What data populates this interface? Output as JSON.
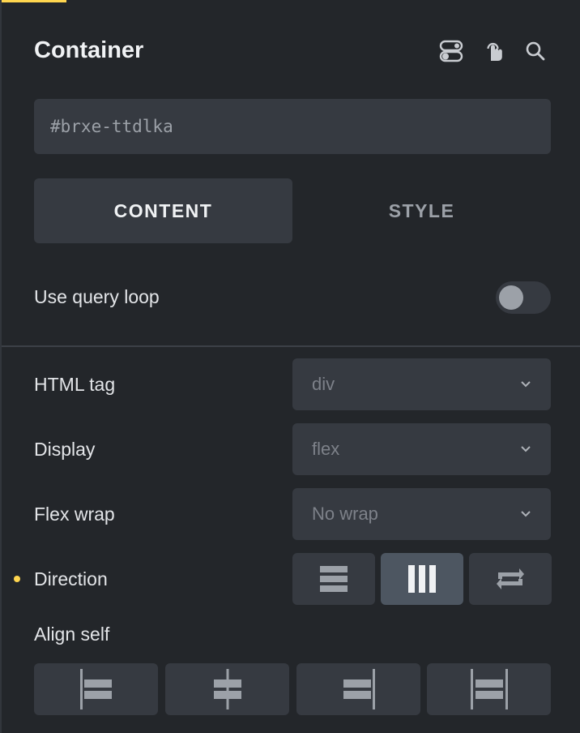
{
  "header": {
    "title": "Container",
    "icons": [
      "toggle-switch-icon",
      "hand-pointer-icon",
      "search-icon"
    ]
  },
  "id_field": {
    "value": "#brxe-ttdlka"
  },
  "tabs": [
    {
      "label": "CONTENT",
      "active": true
    },
    {
      "label": "STYLE",
      "active": false
    }
  ],
  "query_loop": {
    "label": "Use query loop",
    "enabled": false
  },
  "fields": {
    "html_tag": {
      "label": "HTML tag",
      "placeholder": "div"
    },
    "display": {
      "label": "Display",
      "placeholder": "flex"
    },
    "flex_wrap": {
      "label": "Flex wrap",
      "placeholder": "No wrap"
    },
    "direction": {
      "label": "Direction",
      "options": [
        "column",
        "row",
        "reverse"
      ],
      "selected": "row"
    },
    "align_self": {
      "label": "Align self",
      "options": [
        "flex-start",
        "center",
        "flex-end",
        "stretch"
      ]
    }
  },
  "colors": {
    "accent": "#ffd64f",
    "background": "#23262a",
    "control": "#363a41",
    "active_control": "#4d5661"
  }
}
